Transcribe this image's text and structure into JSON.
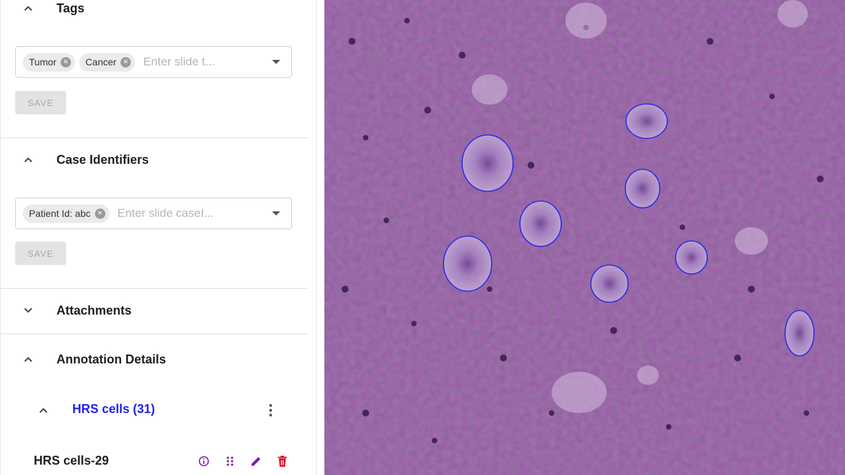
{
  "sidebar": {
    "tags": {
      "title": "Tags",
      "chips": [
        "Tumor",
        "Cancer"
      ],
      "placeholder": "Enter slide t...",
      "save_label": "SAVE"
    },
    "case_identifiers": {
      "title": "Case Identifiers",
      "chips": [
        "Patient Id: abc"
      ],
      "placeholder": "Enter slide caseI...",
      "save_label": "SAVE"
    },
    "attachments": {
      "title": "Attachments"
    },
    "annotation_details": {
      "title": "Annotation Details",
      "group": {
        "label": "HRS cells (31)",
        "color": "#2323e6"
      },
      "item": {
        "label": "HRS cells-29"
      }
    }
  },
  "colors": {
    "annotation_outline": "#2a2ae8",
    "icon_purple": "#7a1fa2",
    "delete_red": "#e0102a"
  },
  "icons": {
    "info": "info-icon",
    "drag": "drag-handle-icon",
    "edit": "pencil-icon",
    "delete": "trash-icon",
    "more": "more-vert-icon"
  }
}
